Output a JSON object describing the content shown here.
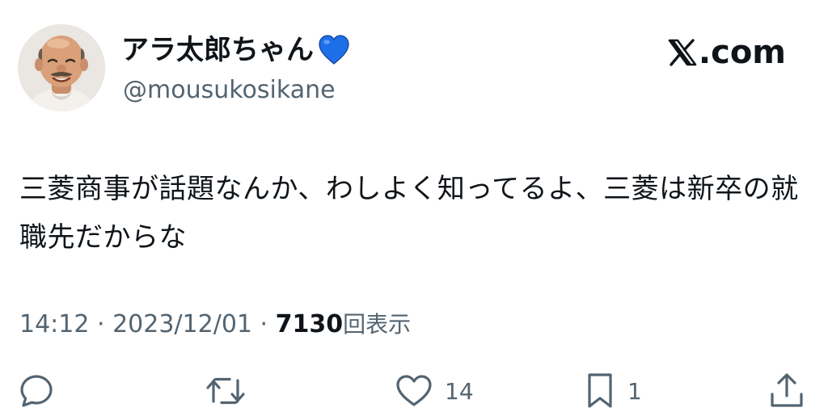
{
  "author": {
    "display_name": "アラ太郎ちゃん",
    "handle": "@mousukosikane",
    "badge_icon": "blue-heart-icon",
    "badge_color": "#1d6fe8"
  },
  "brand": {
    "label": ".com",
    "icon": "x-logo-icon"
  },
  "tweet": {
    "text": "三菱商事が話題なんか、わしよく知ってるよ、三菱は新卒の就職先だからな",
    "time": "14:12",
    "separator1": " · ",
    "date": "2023/12/01",
    "separator2": " · ",
    "views_count": "7130",
    "views_label": "回表示"
  },
  "actions": {
    "reply": {
      "icon": "reply-icon",
      "count": ""
    },
    "retweet": {
      "icon": "retweet-icon",
      "count": ""
    },
    "like": {
      "icon": "heart-icon",
      "count": "14"
    },
    "bookmark": {
      "icon": "bookmark-icon",
      "count": "1"
    },
    "share": {
      "icon": "share-icon",
      "count": ""
    }
  },
  "colors": {
    "text_primary": "#0f1419",
    "text_secondary": "#536471",
    "background": "#ffffff"
  }
}
